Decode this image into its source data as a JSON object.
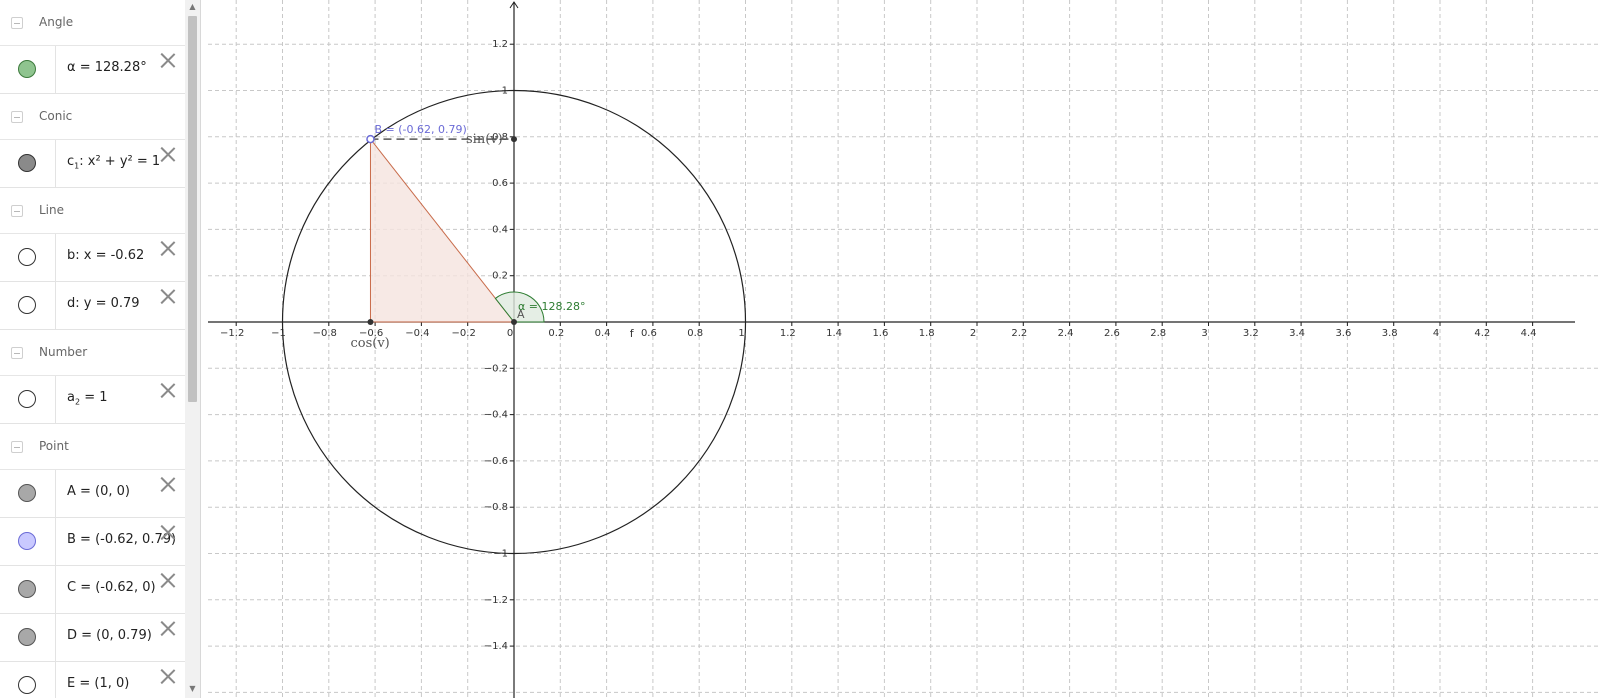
{
  "algebra": {
    "groups": [
      {
        "label": "Angle",
        "items": [
          {
            "text": "α = 128.28°",
            "marble_color": "#8fc48f",
            "marble_border": "#3c7a3c",
            "has_delete": true
          }
        ]
      },
      {
        "label": "Conic",
        "items": [
          {
            "text_html": "c<sub>1</sub>: x² + y² = 1",
            "text": "c1: x² + y² = 1",
            "marble_color": "#8a8a8a",
            "marble_border": "#333333",
            "has_delete": true
          }
        ]
      },
      {
        "label": "Line",
        "items": [
          {
            "text": "b: x = -0.62",
            "marble_color": "#ffffff",
            "marble_border": "#333333",
            "has_delete": true
          },
          {
            "text": "d: y = 0.79",
            "marble_color": "#ffffff",
            "marble_border": "#333333",
            "has_delete": true
          }
        ]
      },
      {
        "label": "Number",
        "items": [
          {
            "text_html": "a<sub>2</sub> = 1",
            "text": "a2 = 1",
            "marble_color": "#ffffff",
            "marble_border": "#333333",
            "has_delete": true
          }
        ]
      },
      {
        "label": "Point",
        "items": [
          {
            "text": "A = (0, 0)",
            "marble_color": "#a8a8a8",
            "marble_border": "#555555",
            "has_delete": true
          },
          {
            "text": "B = (-0.62, 0.79)",
            "marble_color": "#c9c9ff",
            "marble_border": "#6b6bd6",
            "has_delete": true
          },
          {
            "text": "C = (-0.62, 0)",
            "marble_color": "#a8a8a8",
            "marble_border": "#555555",
            "has_delete": true
          },
          {
            "text": "D = (0, 0.79)",
            "marble_color": "#a8a8a8",
            "marble_border": "#555555",
            "has_delete": true
          },
          {
            "text": "E = (1, 0)",
            "marble_color": "#ffffff",
            "marble_border": "#333333",
            "has_delete": true
          }
        ]
      }
    ]
  },
  "graph": {
    "x_min": -1.33,
    "x_max": 4.5,
    "y_min": -1.55,
    "y_max": 1.38,
    "grid": true,
    "x_ticks": [
      "−1.2",
      "−1",
      "−0.8",
      "−0.6",
      "−0.4",
      "−0.2",
      "0",
      "0.2",
      "0.4",
      "0.6",
      "0.8",
      "1",
      "1.2",
      "1.4",
      "1.6",
      "1.8",
      "2",
      "2.2",
      "2.4",
      "2.6",
      "2.8",
      "3",
      "3.2",
      "3.4",
      "3.6",
      "3.8",
      "4",
      "4.2",
      "4.4"
    ],
    "y_ticks": [
      "1.2",
      "1",
      "0.8",
      "0.6",
      "0.4",
      "0.2",
      "−0.2",
      "−0.4",
      "−0.6",
      "−0.8",
      "−1",
      "−1.2",
      "−1.4"
    ],
    "x_tick_values": [
      -1.2,
      -1,
      -0.8,
      -0.6,
      -0.4,
      -0.2,
      0,
      0.2,
      0.4,
      0.6,
      0.8,
      1,
      1.2,
      1.4,
      1.6,
      1.8,
      2,
      2.2,
      2.4,
      2.6,
      2.8,
      3,
      3.2,
      3.4,
      3.6,
      3.8,
      4,
      4.2,
      4.4
    ],
    "y_tick_values": [
      1.2,
      1,
      0.8,
      0.6,
      0.4,
      0.2,
      -0.2,
      -0.4,
      -0.6,
      -0.8,
      -1,
      -1.2,
      -1.4
    ],
    "circle": {
      "center": [
        0,
        0
      ],
      "radius": 1,
      "color": "#222222"
    },
    "point_B": {
      "x": -0.62,
      "y": 0.79,
      "label": "B = (-0.62, 0.79)",
      "color": "#6b6bd6"
    },
    "point_C": {
      "x": -0.62,
      "y": 0
    },
    "point_D": {
      "x": 0,
      "y": 0.79
    },
    "point_A": {
      "x": 0,
      "y": 0,
      "label": "A"
    },
    "triangle": {
      "fill": "#f5e3df",
      "stroke": "#c86b4a"
    },
    "angle": {
      "label": "α = 128.28°",
      "color": "#2e7d32",
      "fill": "#dfeadf"
    },
    "labels": {
      "sin": "sin(v)",
      "cos": "cos(v)",
      "f": "f"
    }
  }
}
